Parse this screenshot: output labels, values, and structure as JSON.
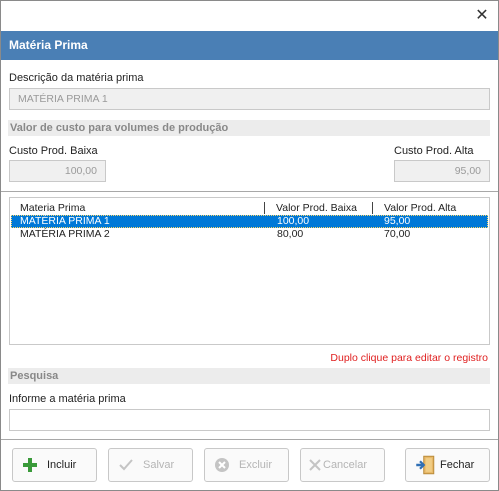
{
  "window": {
    "close_glyph": "✕"
  },
  "header": {
    "title": "Matéria Prima"
  },
  "form": {
    "descricao_label": "Descrição da matéria prima",
    "descricao_value": "MATÉRIA PRIMA 1",
    "custo_section": "Valor de custo para volumes de produção",
    "baixa_label": "Custo Prod. Baixa",
    "baixa_value": "100,00",
    "alta_label": "Custo Prod. Alta",
    "alta_value": "95,00"
  },
  "grid": {
    "columns": [
      "Materia Prima",
      "Valor Prod. Baixa",
      "Valor Prod. Alta"
    ],
    "rows": [
      {
        "materia": "MATÉRIA PRIMA 1",
        "baixa": "100,00",
        "alta": "95,00",
        "selected": true
      },
      {
        "materia": "MATÉRIA PRIMA 2",
        "baixa": "80,00",
        "alta": "70,00",
        "selected": false
      }
    ]
  },
  "hint": "Duplo clique para editar o registro",
  "search": {
    "section": "Pesquisa",
    "label": "Informe a matéria prima",
    "value": ""
  },
  "buttons": {
    "incluir": "Incluir",
    "salvar": "Salvar",
    "excluir": "Excluir",
    "cancelar": "Cancelar",
    "fechar": "Fechar"
  },
  "colors": {
    "header": "#4a7fb5",
    "selection": "#0078d7",
    "hint": "#e02020",
    "add_icon": "#3a9a3a"
  },
  "icons": [
    "close-icon",
    "plus-icon",
    "check-icon",
    "delete-circle-icon",
    "x-icon",
    "exit-door-icon"
  ]
}
